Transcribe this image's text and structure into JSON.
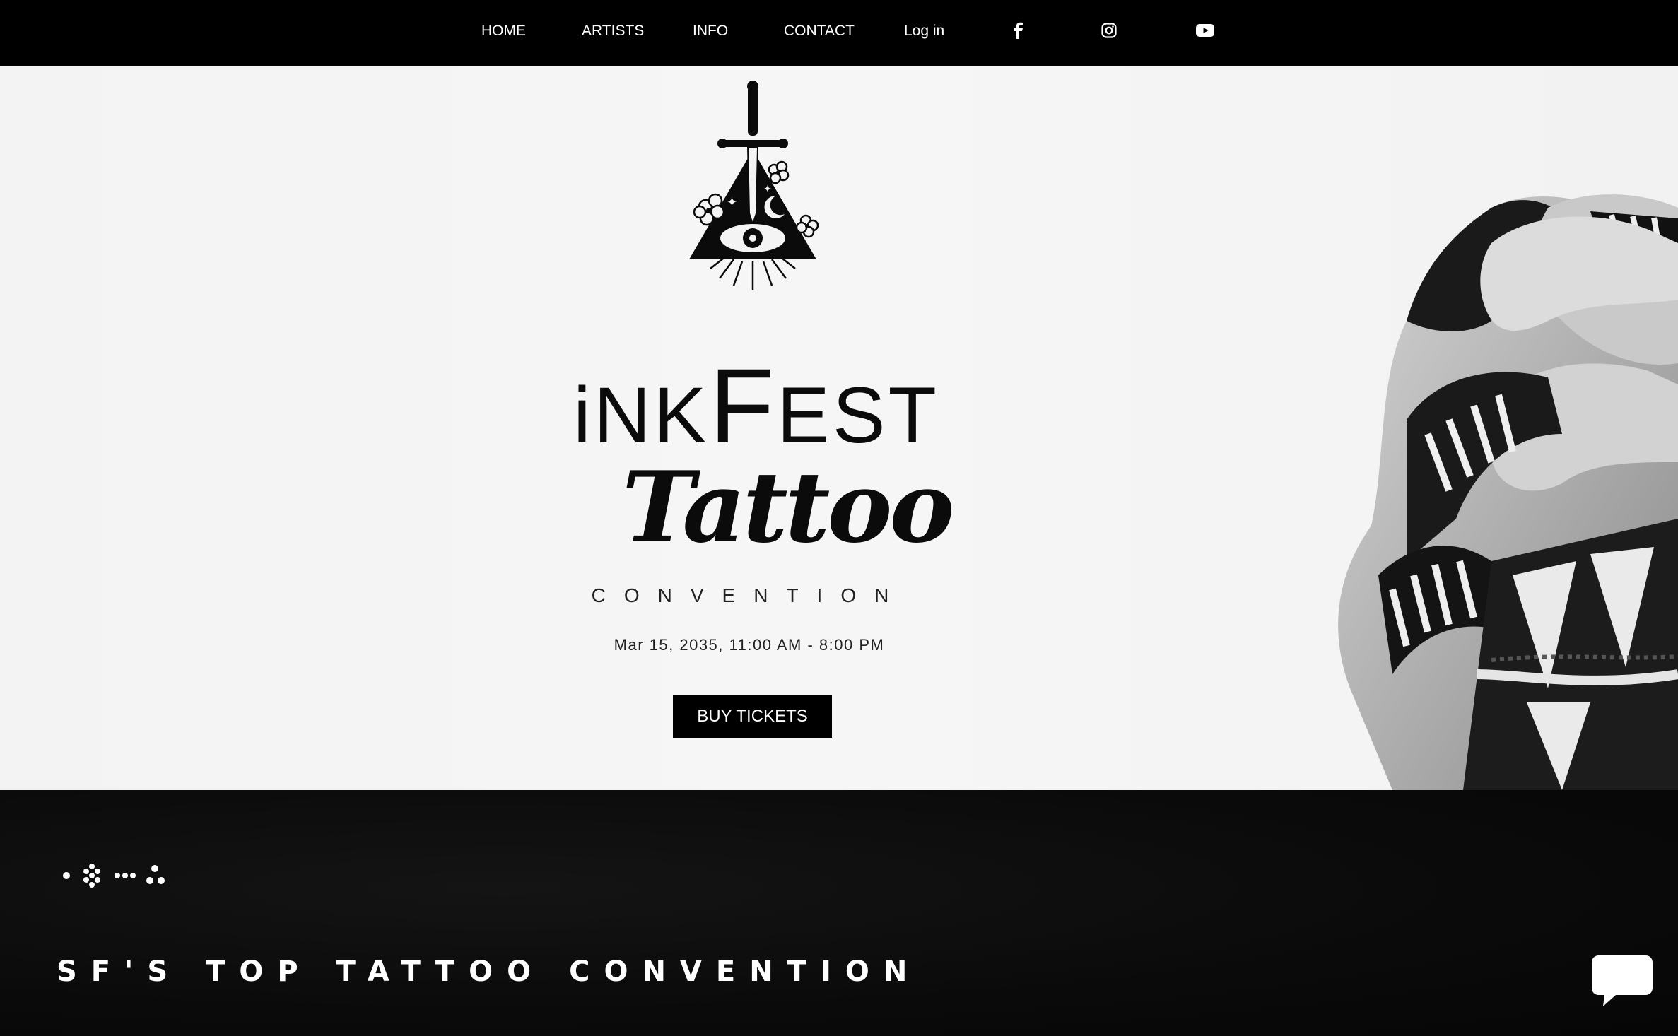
{
  "nav": {
    "items": [
      {
        "label": "HOME"
      },
      {
        "label": "ARTISTS"
      },
      {
        "label": "INFO"
      },
      {
        "label": "CONTACT"
      },
      {
        "label": "Log in"
      }
    ],
    "social": [
      "facebook-icon",
      "instagram-icon",
      "youtube-icon"
    ]
  },
  "hero": {
    "title_first": "iNK",
    "title_mid": "F",
    "title_end": "EST",
    "script_title": "Tattoo",
    "subtitle": "CONVENTION",
    "date": "Mar 15, 2035, 11:00 AM - 8:00 PM",
    "buy_label": "BUY TICKETS"
  },
  "section": {
    "tagline": "SF'S TOP TATTOO CONVENTION"
  },
  "colors": {
    "nav_bg": "#000000",
    "hero_bg": "#f4f4f4",
    "accent": "#000000",
    "text_light": "#ffffff"
  }
}
